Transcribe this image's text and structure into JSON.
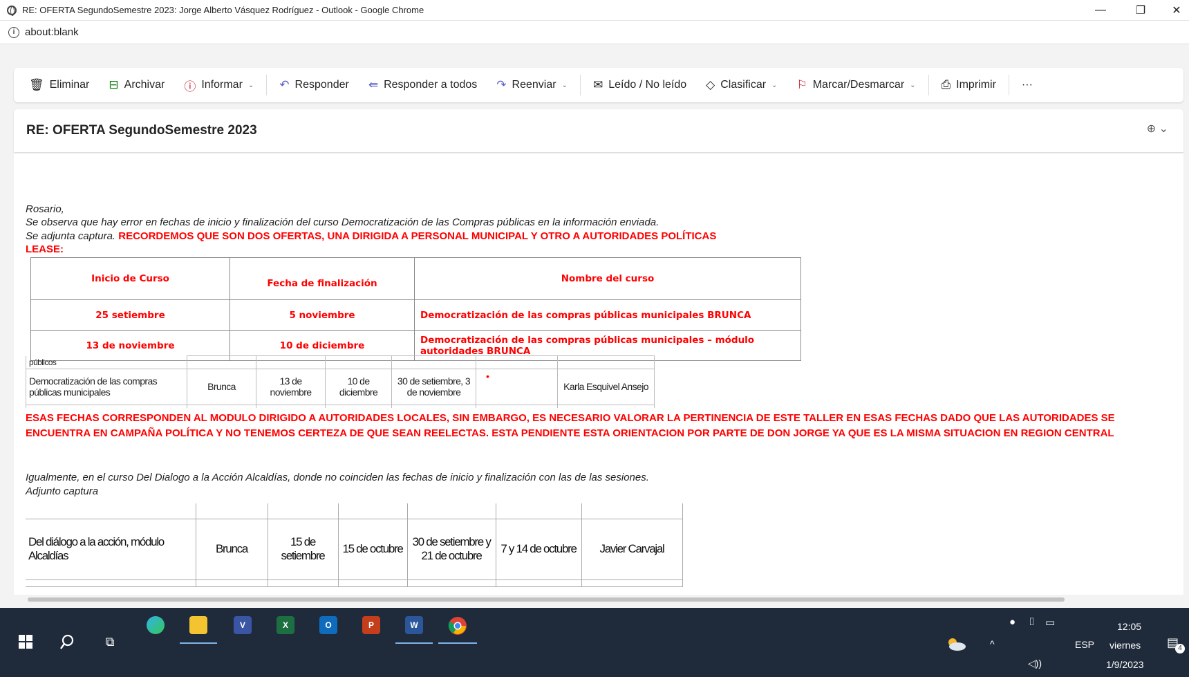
{
  "window": {
    "title": "RE: OFERTA SegundoSemestre 2023: Jorge Alberto Vásquez Rodríguez - Outlook - Google Chrome",
    "url": "about:blank",
    "minimize": "—",
    "restore": "❐",
    "close": "✕"
  },
  "toolbar": {
    "delete": "Eliminar",
    "archive": "Archivar",
    "report": "Informar",
    "reply": "Responder",
    "reply_all": "Responder a todos",
    "forward": "Reenviar",
    "read_unread": "Leído / No leído",
    "categorize": "Clasificar",
    "flag": "Marcar/Desmarcar",
    "print": "Imprimir",
    "more": "···"
  },
  "subject": "RE: OFERTA SegundoSemestre 2023",
  "message": {
    "greeting": "Rosario,",
    "line1": "Se observa que hay error en fechas de inicio y finalización del curso Democratización de las Compras públicas en la información enviada.",
    "line2_prefix": "Se adjunta captura. ",
    "line2_red": "RECORDEMOS QUE SON DOS OFERTAS, UNA DIRIGIDA A PERSONAL MUNICIPAL Y OTRO A AUTORIDADES POLÍTICAS",
    "lease": "LEASE:",
    "table": {
      "headers": [
        "Inicio de Curso",
        "Fecha de finalización",
        "Nombre del curso"
      ],
      "rows": [
        [
          "25 setiembre",
          "5 noviembre",
          "Democratización de las compras públicas municipales BRUNCA"
        ],
        [
          "13 de noviembre",
          "10 de diciembre",
          "Democratización de las compras públicas municipales – módulo autoridades BRUNCA"
        ]
      ]
    },
    "capture1": {
      "top_text": "públicos",
      "row": [
        "Democratización de las  compras públicas municipales",
        "Brunca",
        "13 de noviembre",
        "10 de diciembre",
        "30 de setiembre, 3 de noviembre",
        "•",
        "Karla Esquivel Ansejo"
      ]
    },
    "red_paragraph": "ESAS FECHAS CORRESPONDEN AL MODULO DIRIGIDO A AUTORIDADES LOCALES, SIN EMBARGO, ES NECESARIO VALORAR LA PERTINENCIA DE ESTE TALLER EN ESAS FECHAS DADO QUE LAS AUTORIDADES SE ENCUENTRA EN CAMPAÑA POLÍTICA Y NO TENEMOS CERTEZA DE QUE SEAN REELECTAS. ESTA PENDIENTE ESTA ORIENTACION POR PARTE DE DON JORGE YA QUE ES LA MISMA SITUACION EN REGION CENTRAL",
    "line3": "Igualmente, en el curso Del Dialogo a la Acción Alcaldías, donde no coinciden las fechas de inicio y finalización con las de las sesiones.",
    "line4": "Adjunto captura",
    "capture2": {
      "row": [
        "Del diálogo a la acción, módulo Alcaldías",
        "Brunca",
        "15 de setiembre",
        "15 de octubre",
        "30 de setiembre y 21 de octubre",
        "7 y 14 de octubre",
        "Javier Carvajal"
      ]
    }
  },
  "taskbar": {
    "lang": "ESP",
    "time": "12:05",
    "day": "viernes",
    "date": "1/9/2023",
    "notif_count": "4"
  }
}
